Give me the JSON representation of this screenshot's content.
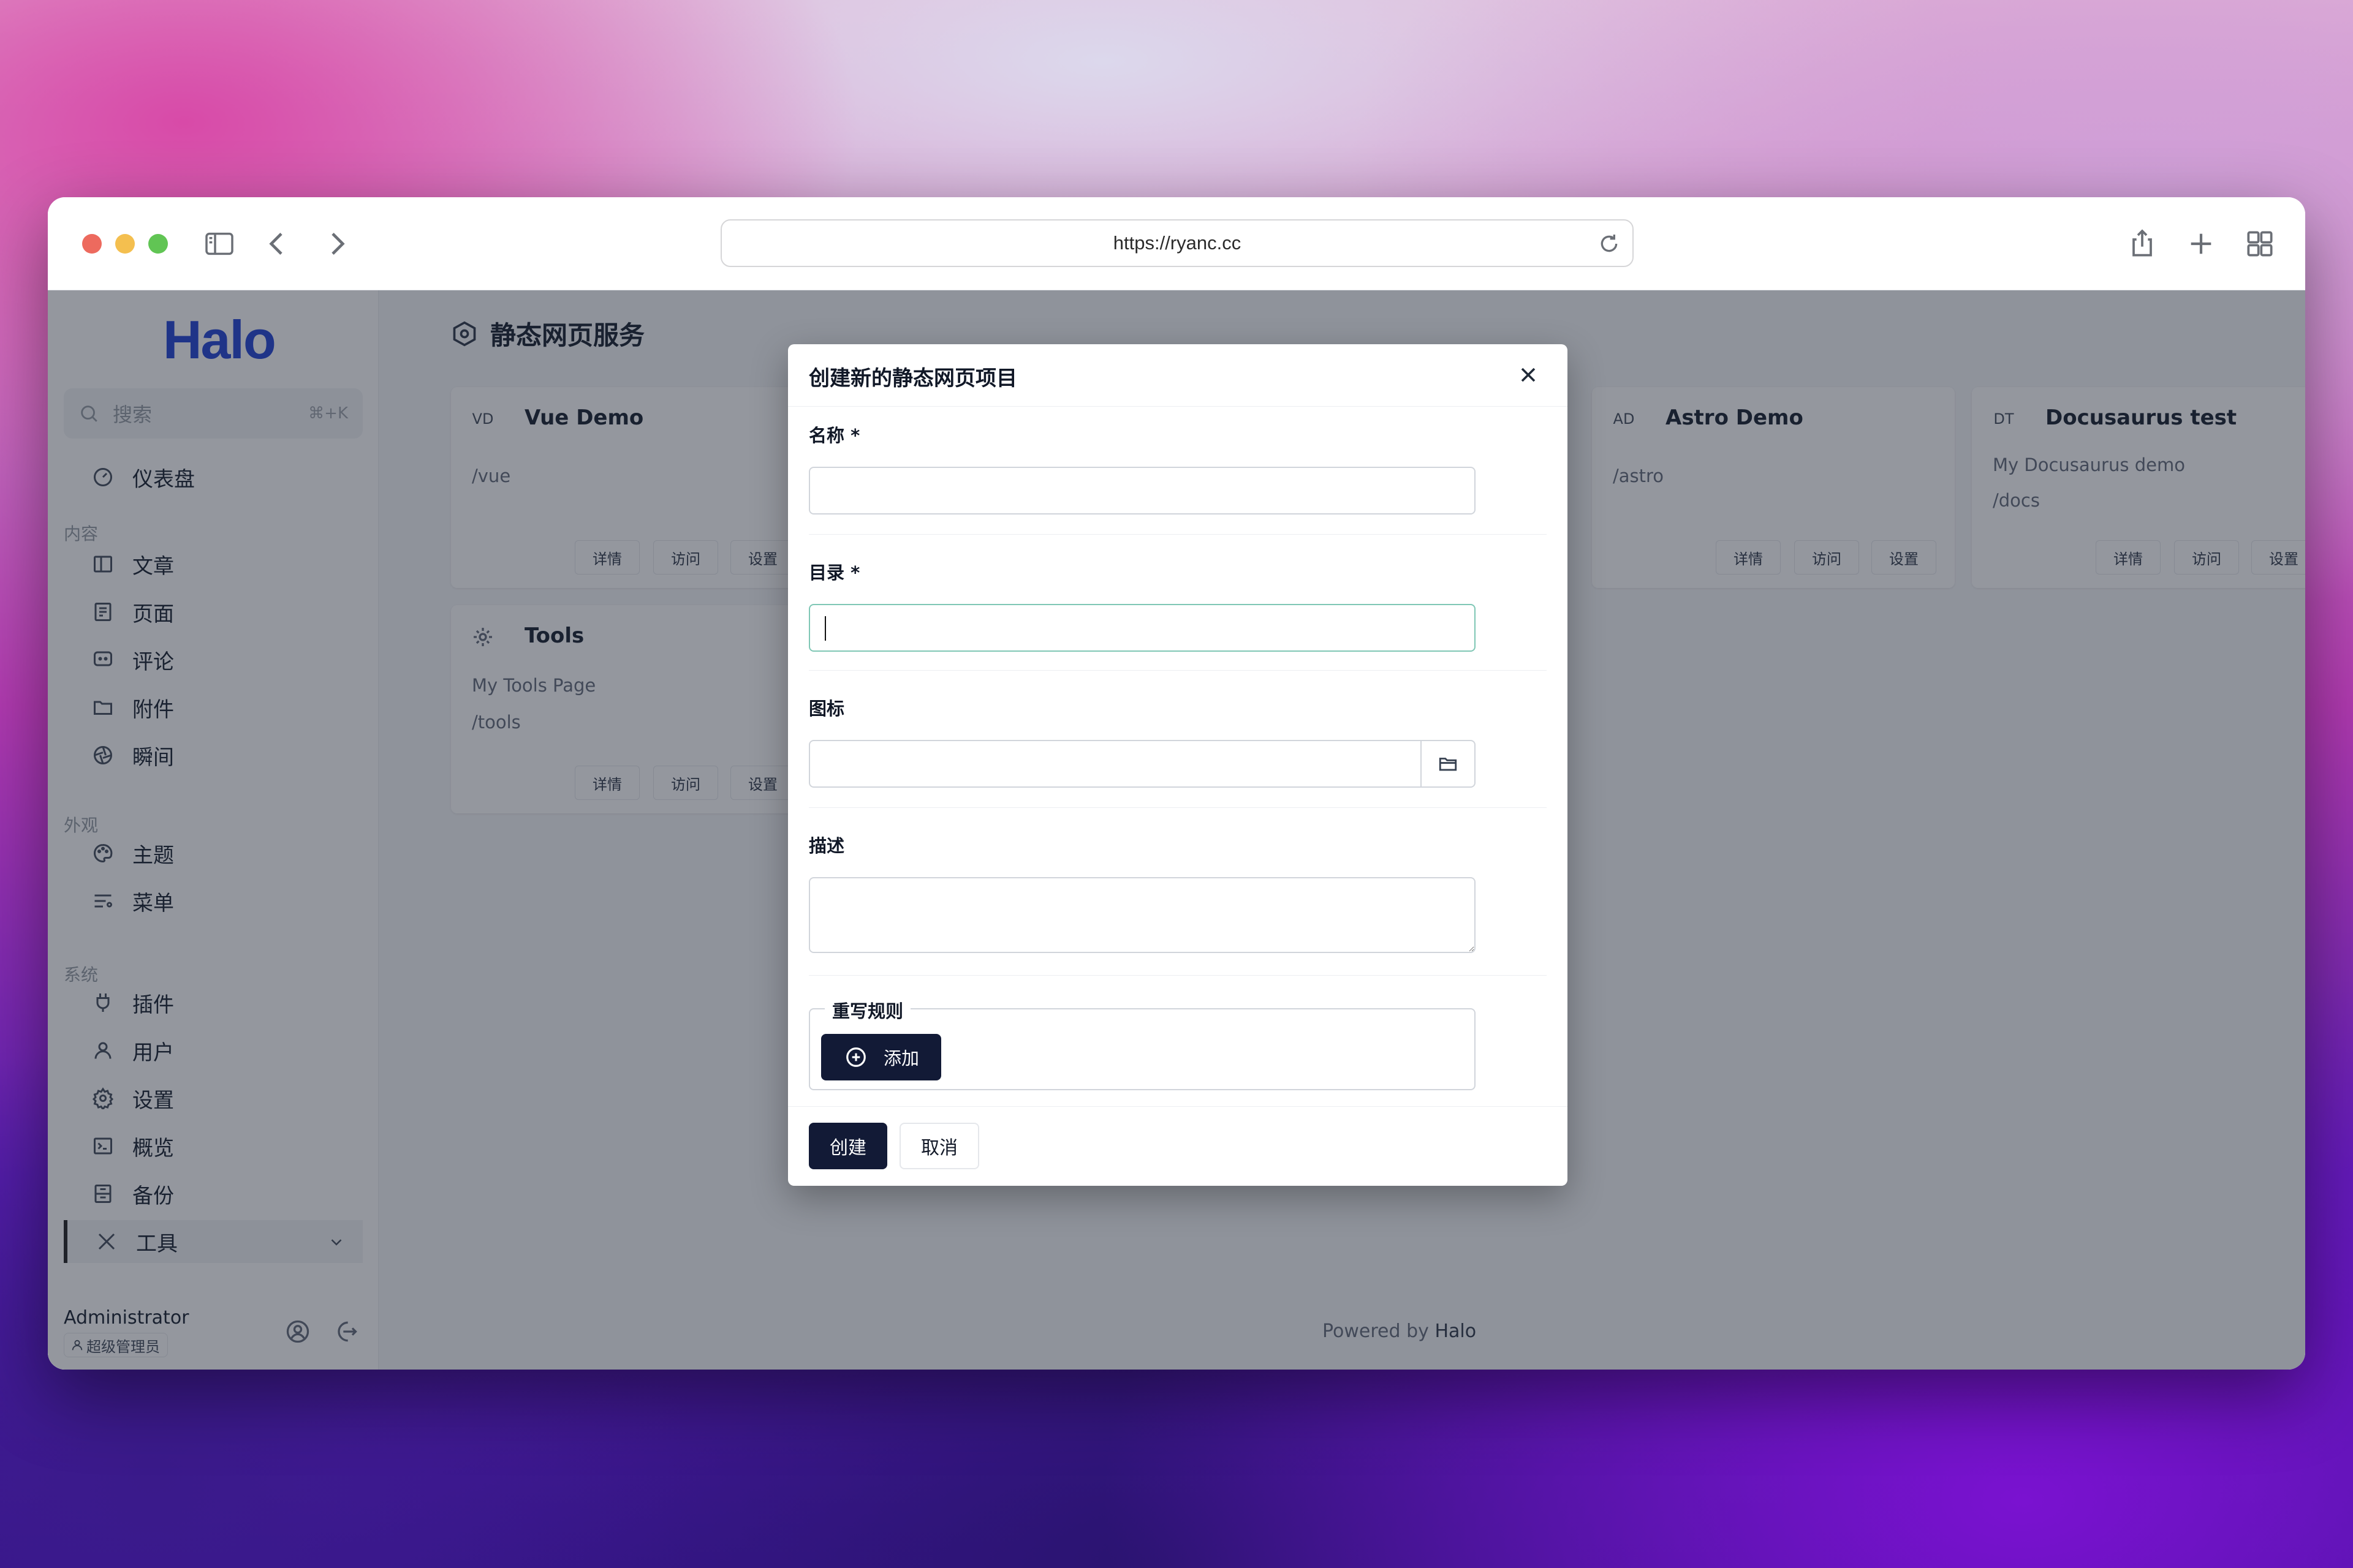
{
  "browser": {
    "url": "https://ryanc.cc"
  },
  "sidebar": {
    "logo": "Halo",
    "search_placeholder": "搜索",
    "search_shortcut": "⌘+K",
    "items": [
      {
        "label": "仪表盘",
        "icon": "dashboard-icon"
      },
      {
        "group": "内容"
      },
      {
        "label": "文章",
        "icon": "book-icon"
      },
      {
        "label": "页面",
        "icon": "page-icon"
      },
      {
        "label": "评论",
        "icon": "comment-icon"
      },
      {
        "label": "附件",
        "icon": "folder-icon"
      },
      {
        "label": "瞬间",
        "icon": "aperture-icon"
      },
      {
        "group": "外观"
      },
      {
        "label": "主题",
        "icon": "palette-icon"
      },
      {
        "label": "菜单",
        "icon": "menu-icon"
      },
      {
        "group": "系统"
      },
      {
        "label": "插件",
        "icon": "plug-icon"
      },
      {
        "label": "用户",
        "icon": "user-icon"
      },
      {
        "label": "设置",
        "icon": "gear-icon"
      },
      {
        "label": "概览",
        "icon": "terminal-icon"
      },
      {
        "label": "备份",
        "icon": "archive-icon"
      },
      {
        "label": "工具",
        "icon": "tools-icon"
      }
    ],
    "user": {
      "name": "Administrator",
      "role": "超级管理员"
    }
  },
  "main": {
    "title": "静态网页服务",
    "cards": [
      {
        "avatar": "VD",
        "title": "Vue Demo",
        "lines": [
          "/vue"
        ]
      },
      {
        "avatar": "",
        "title": "Tools",
        "lines": [
          "My Tools Page",
          "/tools"
        ]
      },
      {
        "avatar": "AD",
        "title": "Astro Demo",
        "lines": [
          "/astro"
        ]
      },
      {
        "avatar": "DT",
        "title": "Docusaurus test",
        "lines": [
          "My Docusaurus demo",
          "/docs"
        ]
      }
    ],
    "card_buttons": {
      "details": "详情",
      "visit": "访问",
      "settings": "设置"
    },
    "footer_prefix": "Powered by",
    "footer_brand": "Halo"
  },
  "modal": {
    "title": "创建新的静态网页项目",
    "fields": {
      "name_label": "名称 *",
      "name_value": "",
      "dir_label": "目录 *",
      "dir_value": "",
      "icon_label": "图标",
      "icon_value": "",
      "desc_label": "描述",
      "desc_value": ""
    },
    "rewrite_label": "重写规则",
    "add_label": "添加",
    "create_label": "创建",
    "cancel_label": "取消"
  }
}
